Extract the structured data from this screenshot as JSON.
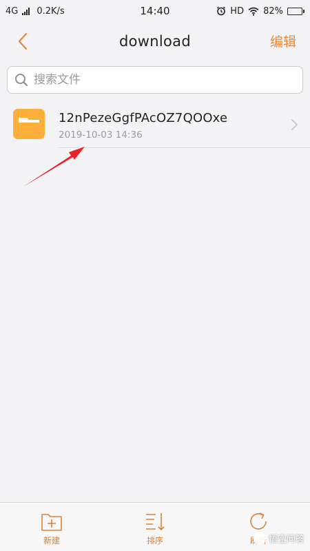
{
  "status_bar": {
    "network": "4G",
    "speed": "0.2K/s",
    "time": "14:40",
    "hd": "HD",
    "battery": "82%",
    "battery_level": 0.82
  },
  "header": {
    "title": "download",
    "edit_label": "编辑"
  },
  "search": {
    "placeholder": "搜索文件"
  },
  "files": [
    {
      "name": "12nPezeGgfPAcOZ7QOOxe",
      "date": "2019-10-03 14:36",
      "icon": "folder-icon"
    }
  ],
  "toolbar": {
    "new_label": "新建",
    "sort_label": "排序",
    "refresh_label": "刷新"
  },
  "watermark": {
    "text": "悟空问答"
  },
  "colors": {
    "accent": "#e58a3b",
    "folder": "#fbb03b",
    "annotation": "#e8232a"
  }
}
